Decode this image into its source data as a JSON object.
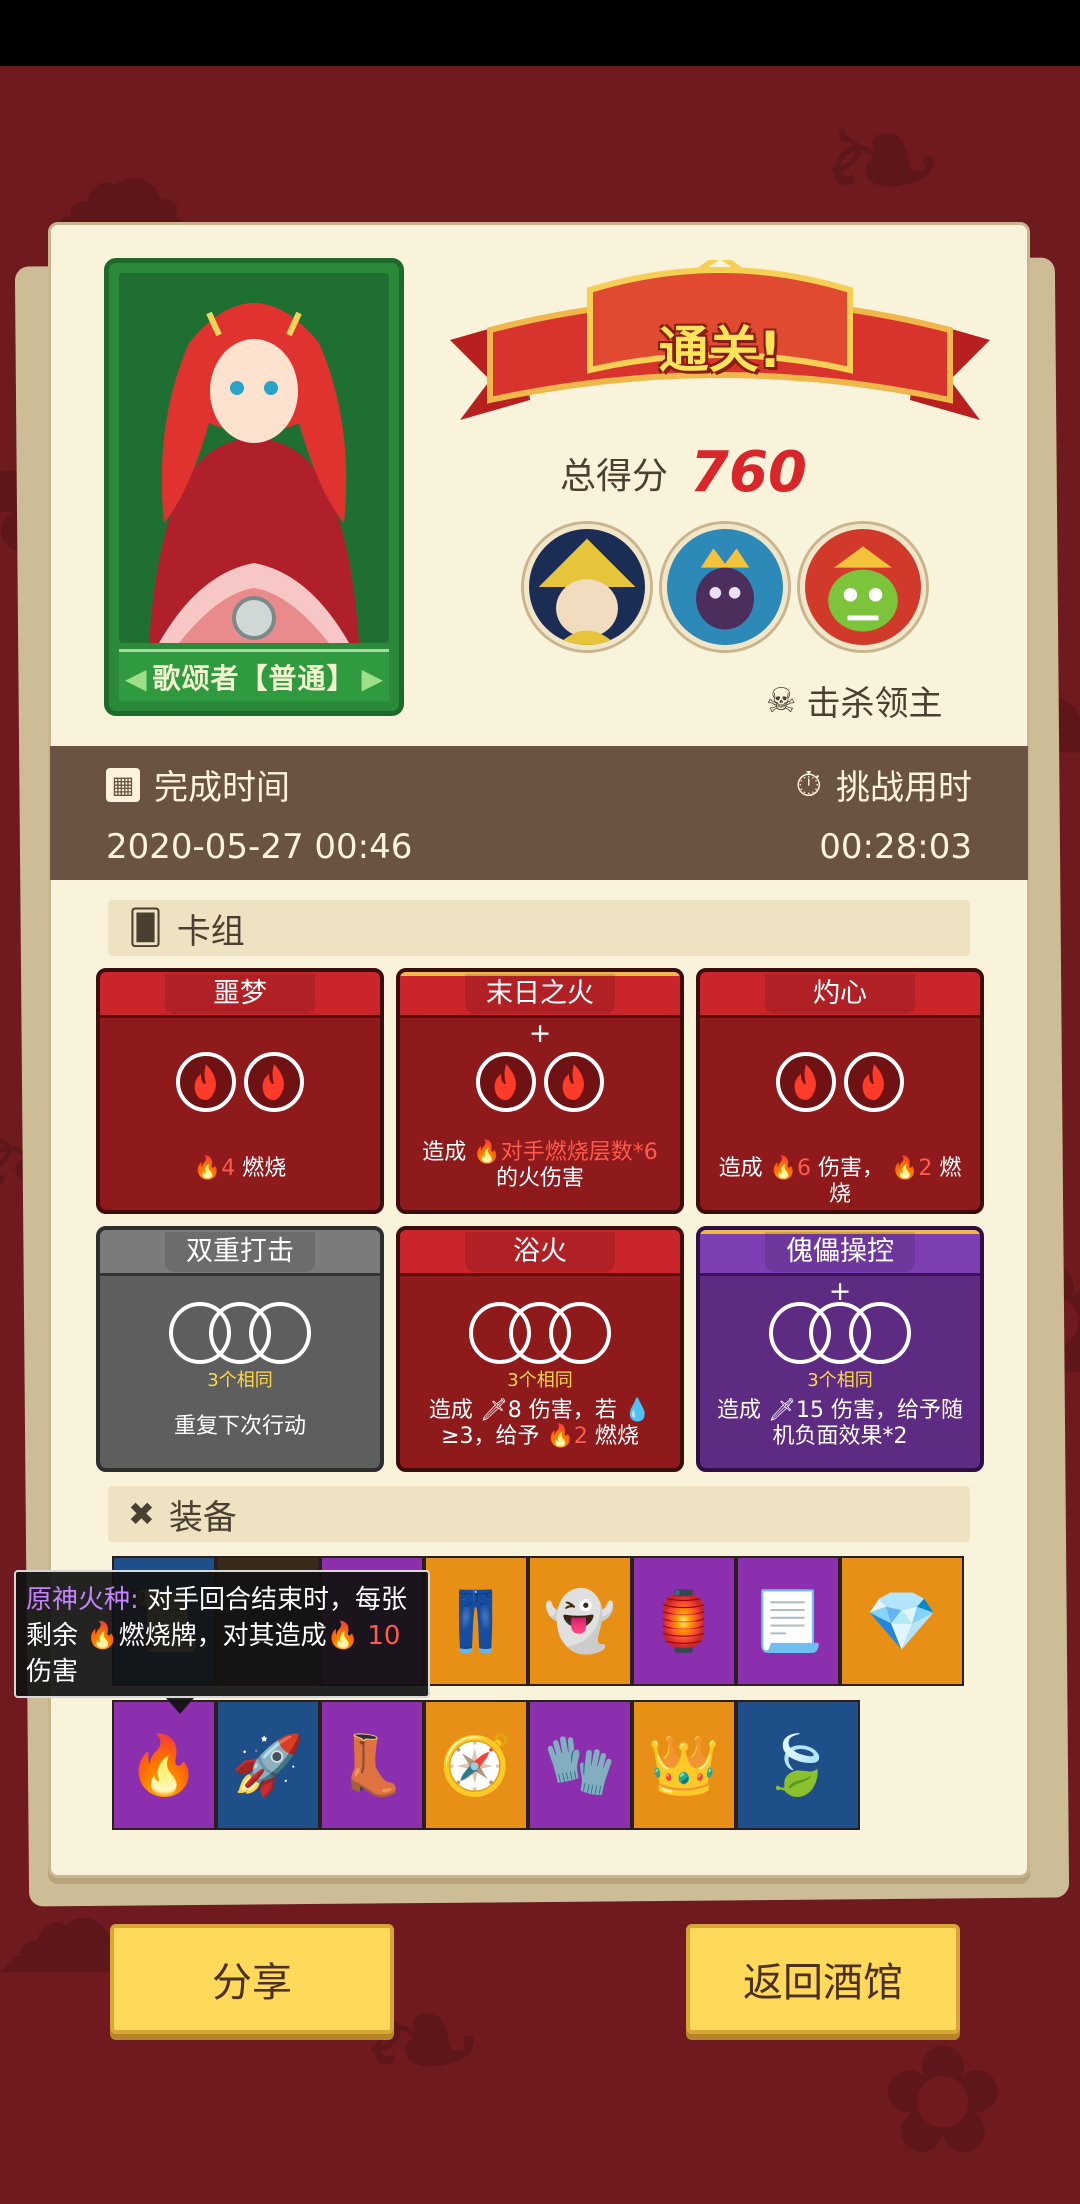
{
  "result": {
    "banner": "通关!",
    "score_label": "总得分",
    "score_value": "760",
    "kill_label": "击杀领主"
  },
  "hero": {
    "name": "歌颂者【普通】"
  },
  "time": {
    "complete_label": "完成时间",
    "complete_value": "2020-05-27 00:46",
    "duration_label": "挑战用时",
    "duration_value": "00:28:03"
  },
  "deck": {
    "title": "卡组",
    "cards": [
      {
        "name": "噩梦",
        "cost": "4",
        "desc_suffix": "燃烧"
      },
      {
        "name": "末日之火+",
        "desc_pre": "造成",
        "desc_hl": "对手燃烧层数*6",
        "desc_post": "的火伤害"
      },
      {
        "name": "灼心",
        "desc_pre": "造成",
        "dmg": "6",
        "desc_mid": "伤害，",
        "burn": "2",
        "desc_post": "燃烧"
      },
      {
        "name": "双重打击",
        "same": "3个相同",
        "desc": "重复下次行动"
      },
      {
        "name": "浴火",
        "same": "3个相同",
        "desc_pre": "造成",
        "dmg": "8",
        "desc_mid": "伤害，若",
        "cond": "≥3",
        "desc_mid2": "，给予",
        "burn": "2",
        "desc_post": "燃烧"
      },
      {
        "name": "傀儡操控+",
        "same": "3个相同",
        "desc_pre": "造成",
        "dmg": "15",
        "desc_post": "伤害，给予随机负面效果*2"
      }
    ]
  },
  "equipment": {
    "title": "装备",
    "tooltip": {
      "name": "原神火种",
      "colon": ":",
      "text1": "对手回合结束时，每张剩余",
      "text2": "燃烧牌，对其造成",
      "value": "10",
      "text3": "伤害"
    },
    "row1": [
      {
        "color": "#1f4f88",
        "icon": "scroll-icon"
      },
      {
        "color": "#3a2a1a",
        "icon": "dark-item-icon"
      },
      {
        "color": "#8b2fae",
        "icon": "dark-item-icon"
      },
      {
        "color": "#e88f16",
        "icon": "pants-icon"
      },
      {
        "color": "#e88f16",
        "icon": "ghost-hand-icon"
      },
      {
        "color": "#8b2fae",
        "icon": "lantern-icon"
      },
      {
        "color": "#8b2fae",
        "icon": "parchment-icon"
      },
      {
        "color": "#e88f16",
        "icon": "diamond-icon"
      }
    ],
    "row2": [
      {
        "color": "#8b2fae",
        "icon": "campfire-icon"
      },
      {
        "color": "#1f4f88",
        "icon": "skull-rocket-icon"
      },
      {
        "color": "#8b2fae",
        "icon": "boot-icon"
      },
      {
        "color": "#e88f16",
        "icon": "compass-icon"
      },
      {
        "color": "#8b2fae",
        "icon": "fire-gauntlet-icon"
      },
      {
        "color": "#e88f16",
        "icon": "crown-icon"
      },
      {
        "color": "#1f4f88",
        "icon": "leaf-ring-icon"
      }
    ]
  },
  "buttons": {
    "share": "分享",
    "back": "返回酒馆"
  },
  "colors": {
    "background": "#6e1a1e",
    "paper": "#faf3dc",
    "score": "#d9262a",
    "button": "#ffd95a"
  }
}
